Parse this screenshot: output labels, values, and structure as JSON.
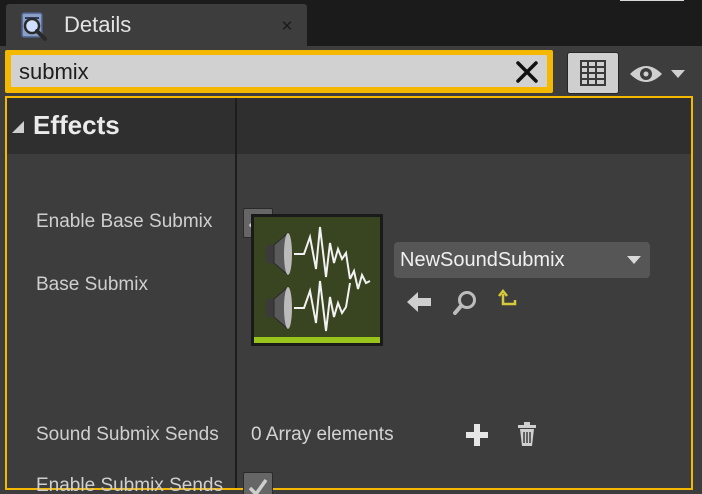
{
  "tab": {
    "label": "Details",
    "icon": "details-magnifier-icon",
    "close_icon": "close-tab-icon"
  },
  "search": {
    "value": "submix",
    "clear_icon": "clear-search-icon"
  },
  "toolbar": {
    "view_options_icon": "grid-view-icon",
    "visibility_icon": "eye-icon"
  },
  "category": {
    "label": "Effects",
    "expanded": true
  },
  "properties": {
    "enable_base_submix": {
      "label": "Enable Base Submix",
      "checked": true
    },
    "base_submix": {
      "label": "Base Submix",
      "asset_name": "NewSoundSubmix",
      "thumbnail_icon": "sound-submix-icon"
    },
    "sound_submix_sends": {
      "label": "Sound Submix Sends",
      "value": "0 Array elements"
    },
    "enable_submix_sends": {
      "label": "Enable Submix Sends",
      "checked": true
    }
  },
  "colors": {
    "accent": "#f5b800",
    "panel": "#3d3d3d",
    "thumbnail_bg": "#394420",
    "asset_type_bar": "#98c41b",
    "reset_yellow": "#d7c93a"
  }
}
